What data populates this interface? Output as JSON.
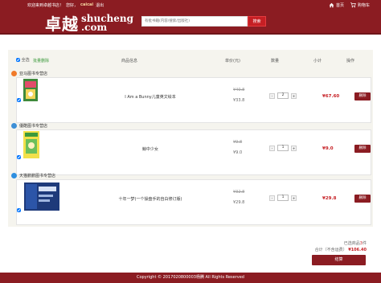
{
  "topbar": {
    "welcome": "欢迎来到卓越书店！",
    "greeting": "您好，",
    "username": "caicai",
    "logout": "退出",
    "home": "首页",
    "cart": "购物车"
  },
  "logo": {
    "cn": "卓越",
    "en_top": "shucheng",
    "en_bottom": ".com"
  },
  "search": {
    "placeholder": "有批书籍(内容/搜索/出版社)",
    "button": "搜索"
  },
  "columns": {
    "select_all": "全选",
    "batch_delete": "批量删除",
    "product": "商品信息",
    "unit_price": "单价(元)",
    "quantity": "数量",
    "subtotal": "小计",
    "operation": "操作"
  },
  "stores": [
    {
      "name": "亚马图书专营店",
      "icon_color": "#f07a2a",
      "item": {
        "title": "I Am a Bunny儿童英文绘本",
        "old_price": "¥40.8",
        "price": "¥33.8",
        "qty": "2",
        "subtotal": "¥67.60",
        "delete": "删除"
      }
    },
    {
      "name": "優酷图书专营店",
      "icon_color": "#3d8fd6",
      "item": {
        "title": "鲸中少女",
        "old_price": "¥9.8",
        "price": "¥9.0",
        "qty": "1",
        "subtotal": "¥9.0",
        "delete": "删除"
      }
    },
    {
      "name": "天猫鹏鹏图书专营店",
      "icon_color": "#2e8fe0",
      "item": {
        "title": "十年一梦(一个操盘手的自白修订版)",
        "old_price": "¥32.8",
        "price": "¥29.8",
        "qty": "1",
        "subtotal": "¥29.8",
        "delete": "删除"
      }
    }
  ],
  "summary": {
    "selected_prefix": "已选商品",
    "selected_count": "3",
    "selected_suffix": "件",
    "total_label": "合计（不含运费）",
    "total": "¥106.40",
    "checkout": "结算"
  },
  "footer": "Copyright © 2017020800003杨腾 All Rights Reserved",
  "colors": {
    "brand": "#8b1c22",
    "accent": "#c61f24"
  }
}
